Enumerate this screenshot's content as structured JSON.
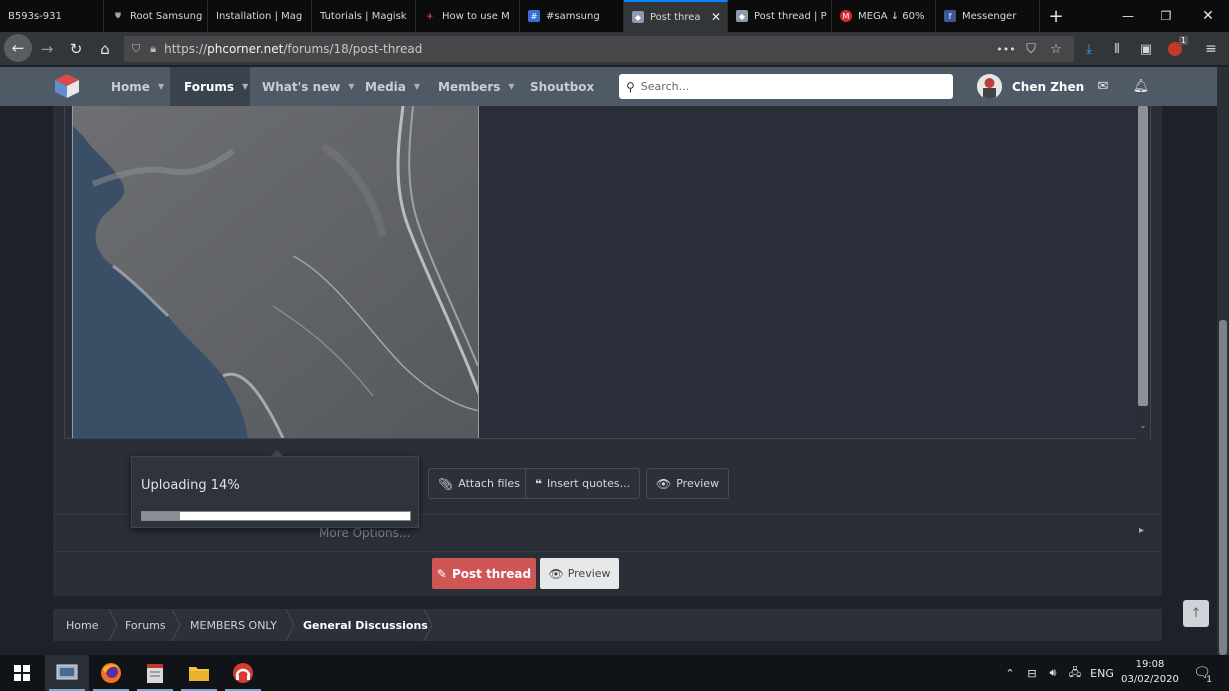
{
  "browser": {
    "tabs": [
      {
        "label": "B593s-931",
        "icon": "none"
      },
      {
        "label": "Root Samsung",
        "icon": "shield-icon"
      },
      {
        "label": "Installation | Mag",
        "icon": "none"
      },
      {
        "label": "Tutorials | Magisk",
        "icon": "none"
      },
      {
        "label": "How to use M",
        "icon": "xda-icon"
      },
      {
        "label": "#samsung",
        "icon": "instagram-icon"
      },
      {
        "label": "Post threa",
        "icon": "phcorner-icon",
        "active": true
      },
      {
        "label": "Post thread | P",
        "icon": "phcorner-icon"
      },
      {
        "label": "MEGA ↓ 60%",
        "icon": "mega-icon"
      },
      {
        "label": "Messenger",
        "icon": "facebook-icon"
      }
    ],
    "new_tab": "+",
    "url_prefix": "https://",
    "url_domain": "phcorner.net",
    "url_path": "/forums/18/post-thread",
    "menu_dots": "•••",
    "ext_badge": "1"
  },
  "site": {
    "nav": [
      {
        "label": "Home",
        "dropdown": true
      },
      {
        "label": "Forums",
        "dropdown": true,
        "selected": true
      },
      {
        "label": "What's new",
        "dropdown": true
      },
      {
        "label": "Media",
        "dropdown": true
      },
      {
        "label": "Members",
        "dropdown": true
      },
      {
        "label": "Shoutbox",
        "dropdown": false
      }
    ],
    "search_placeholder": "Search...",
    "username": "Chen Zhen"
  },
  "editor": {
    "toolbar": {
      "attach": "Attach files",
      "insert_quotes": "Insert quotes...",
      "preview": "Preview"
    },
    "upload": {
      "label": "Uploading 14%",
      "progress": 0.14
    },
    "more_options": "More Options...",
    "post_thread": "Post thread",
    "preview": "Preview"
  },
  "breadcrumbs": [
    "Home",
    "Forums",
    "MEMBERS ONLY",
    "General Discussions"
  ],
  "taskbar": {
    "lang": "ENG",
    "time": "19:08",
    "date": "03/02/2020",
    "notif_count": "1"
  },
  "colors": {
    "accent_post": "#d05656",
    "header_bg": "#4f5a66",
    "page_bg": "#1e2129"
  }
}
